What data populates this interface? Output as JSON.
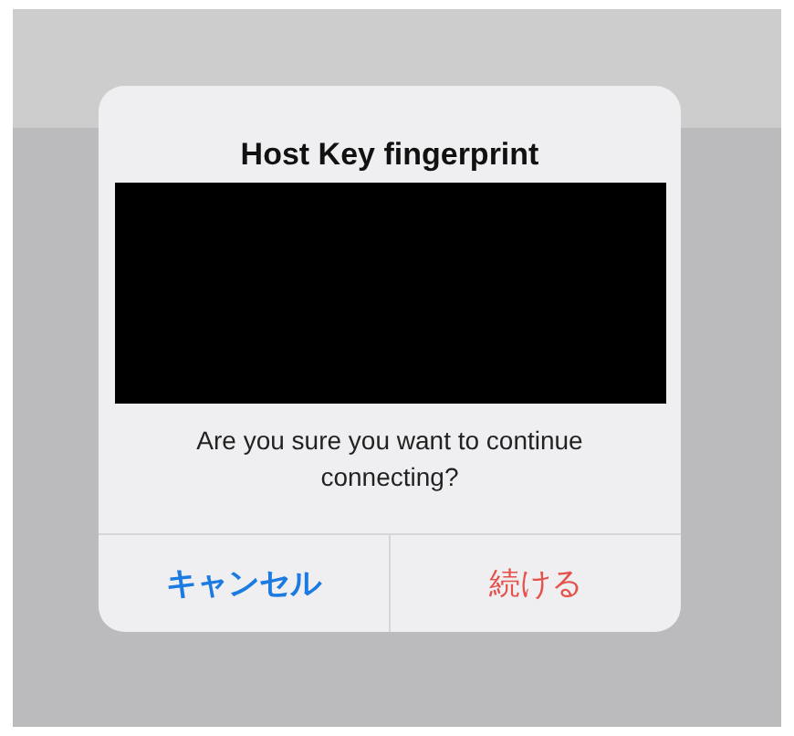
{
  "alert": {
    "title": "Host Key fingerprint",
    "fingerprint": {
      "redacted": true
    },
    "message": "Are you sure you want to continue connecting?",
    "buttons": [
      {
        "label": "キャンセル",
        "kind": "cancel"
      },
      {
        "label": "続ける",
        "kind": "destructive"
      }
    ]
  }
}
